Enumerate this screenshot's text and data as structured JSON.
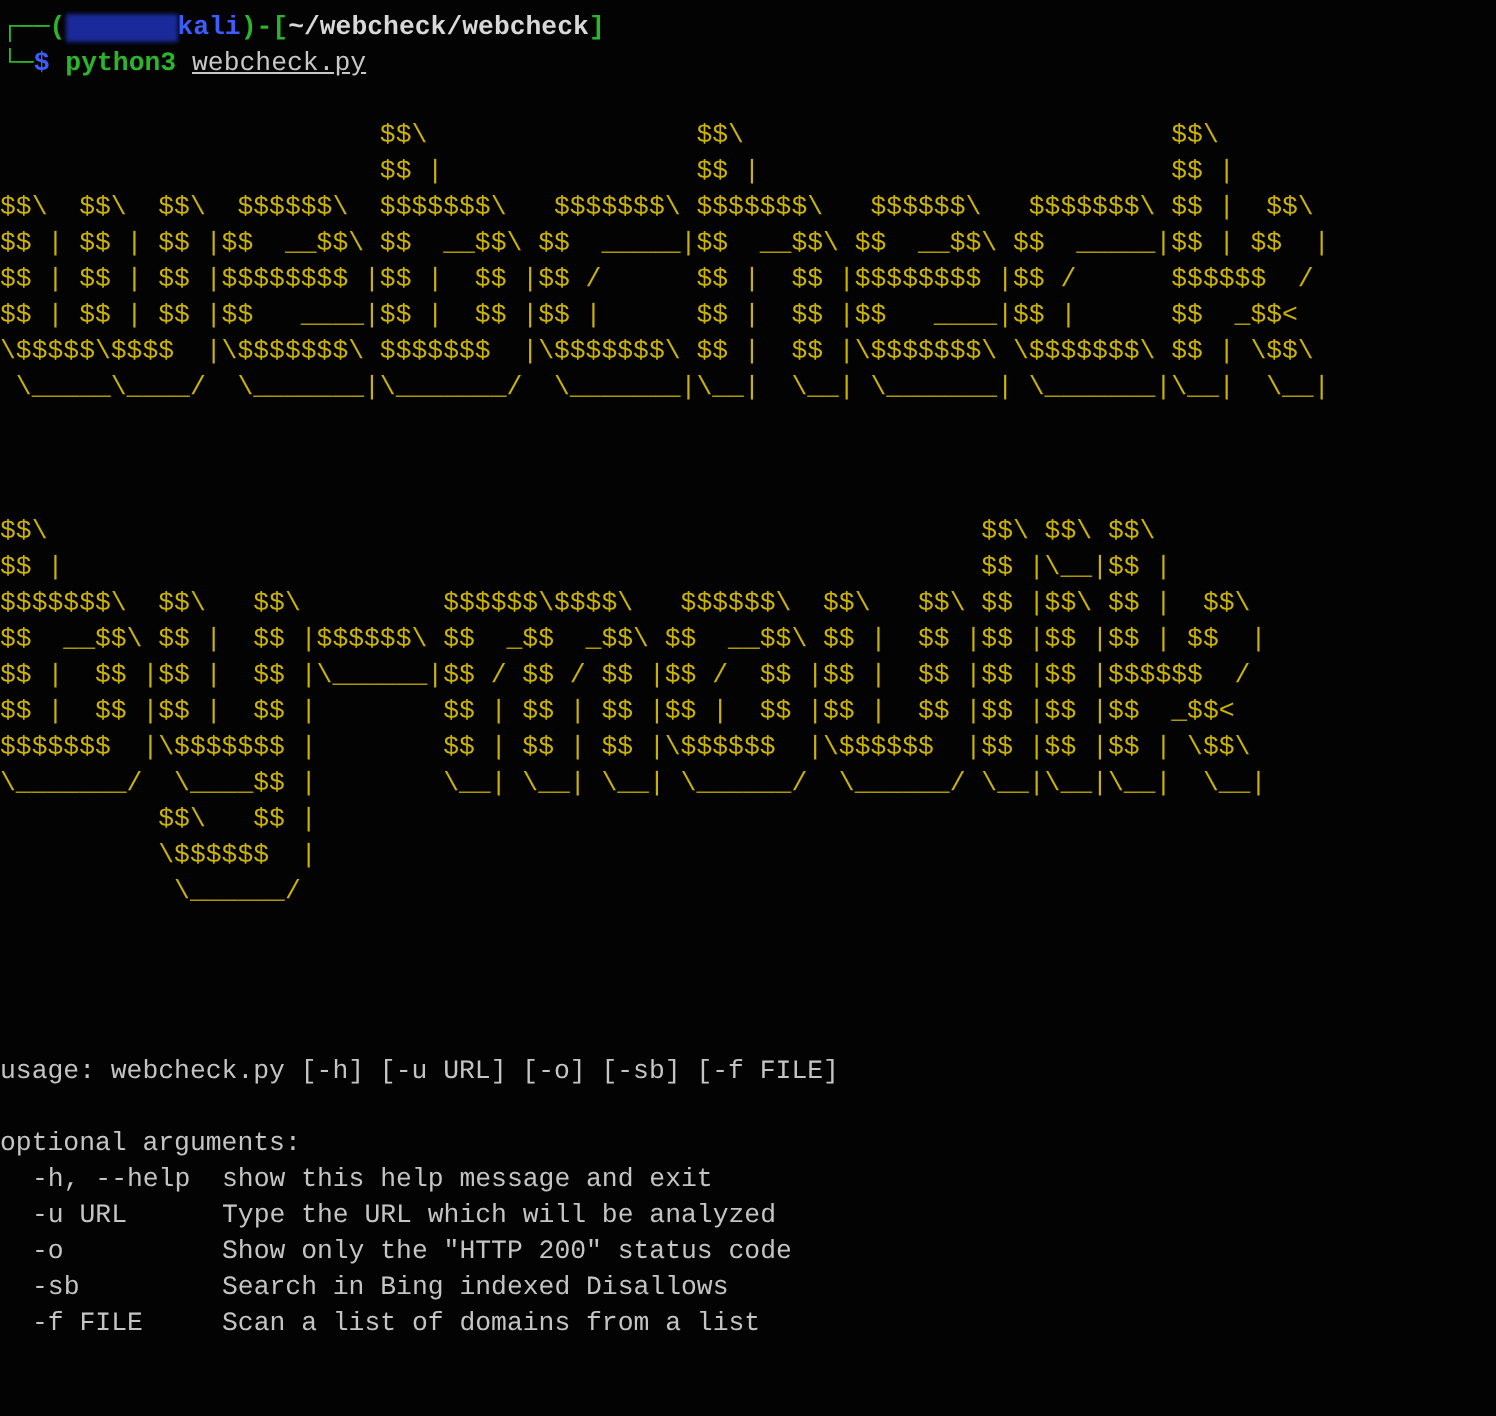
{
  "prompt": {
    "open": "┌──(",
    "user_redacted": true,
    "host": "kali",
    "separator": ")-[",
    "path": "~/webcheck/webcheck",
    "close": "]"
  },
  "command": {
    "lead": "└─",
    "symbol": "$",
    "program": "python3",
    "argument": "webcheck.py"
  },
  "banners": [
    {
      "lines": [
        "                        $$\\                 $$\\                           $$\\",
        "                        $$ |                $$ |                          $$ |",
        "$$\\  $$\\  $$\\  $$$$$$\\  $$$$$$$\\   $$$$$$$\\ $$$$$$$\\   $$$$$$\\   $$$$$$$\\ $$ |  $$\\",
        "$$ | $$ | $$ |$$  __$$\\ $$  __$$\\ $$  _____|$$  __$$\\ $$  __$$\\ $$  _____|$$ | $$  |",
        "$$ | $$ | $$ |$$$$$$$$ |$$ |  $$ |$$ /      $$ |  $$ |$$$$$$$$ |$$ /      $$$$$$  /",
        "$$ | $$ | $$ |$$   ____|$$ |  $$ |$$ |      $$ |  $$ |$$   ____|$$ |      $$  _$$<",
        "\\$$$$$\\$$$$  |\\$$$$$$$\\ $$$$$$$  |\\$$$$$$$\\ $$ |  $$ |\\$$$$$$$\\ \\$$$$$$$\\ $$ | \\$$\\",
        " \\_____\\____/  \\_______|\\_______/  \\_______|\\__|  \\__| \\_______| \\_______|\\__|  \\__|"
      ]
    },
    {
      "lines": [
        "$$\\                                                           $$\\ $$\\ $$\\",
        "$$ |                                                          $$ |\\__|$$ |",
        "$$$$$$$\\  $$\\   $$\\         $$$$$$\\$$$$\\   $$$$$$\\  $$\\   $$\\ $$ |$$\\ $$ |  $$\\",
        "$$  __$$\\ $$ |  $$ |$$$$$$\\ $$  _$$  _$$\\ $$  __$$\\ $$ |  $$ |$$ |$$ |$$ | $$  |",
        "$$ |  $$ |$$ |  $$ |\\______|$$ / $$ / $$ |$$ /  $$ |$$ |  $$ |$$ |$$ |$$$$$$  /",
        "$$ |  $$ |$$ |  $$ |        $$ | $$ | $$ |$$ |  $$ |$$ |  $$ |$$ |$$ |$$  _$$<",
        "$$$$$$$  |\\$$$$$$$ |        $$ | $$ | $$ |\\$$$$$$  |\\$$$$$$  |$$ |$$ |$$ | \\$$\\",
        "\\_______/  \\____$$ |        \\__| \\__| \\__| \\______/  \\______/ \\__|\\__|\\__|  \\__|",
        "          $$\\   $$ |",
        "          \\$$$$$$  |",
        "           \\______/"
      ]
    }
  ],
  "usage": "usage: webcheck.py [-h] [-u URL] [-o] [-sb] [-f FILE]",
  "help": {
    "heading": "optional arguments:",
    "options": [
      {
        "flag": "-h, --help",
        "description": "show this help message and exit"
      },
      {
        "flag": "-u URL",
        "description": "Type the URL which will be analyzed"
      },
      {
        "flag": "-o",
        "description": "Show only the \"HTTP 200\" status code"
      },
      {
        "flag": "-sb",
        "description": "Search in Bing indexed Disallows"
      },
      {
        "flag": "-f FILE",
        "description": "Scan a list of domains from a list"
      }
    ]
  }
}
